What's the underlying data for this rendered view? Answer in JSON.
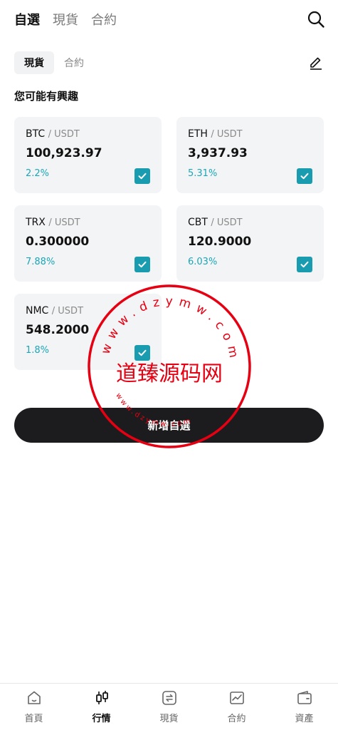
{
  "header": {
    "tabs": [
      {
        "label": "自選",
        "active": true
      },
      {
        "label": "現貨",
        "active": false
      },
      {
        "label": "合約",
        "active": false
      }
    ]
  },
  "sub_tabs": [
    {
      "label": "現貨",
      "active": true
    },
    {
      "label": "合約",
      "active": false
    }
  ],
  "section_title": "您可能有興趣",
  "cards": [
    {
      "base": "BTC",
      "quote": "/ USDT",
      "price": "100,923.97",
      "change": "2.2%",
      "checked": true
    },
    {
      "base": "ETH",
      "quote": "/ USDT",
      "price": "3,937.93",
      "change": "5.31%",
      "checked": true
    },
    {
      "base": "TRX",
      "quote": "/ USDT",
      "price": "0.300000",
      "change": "7.88%",
      "checked": true
    },
    {
      "base": "CBT",
      "quote": "/ USDT",
      "price": "120.9000",
      "change": "6.03%",
      "checked": true
    },
    {
      "base": "NMC",
      "quote": "/ USDT",
      "price": "548.2000",
      "change": "1.8%",
      "checked": true
    }
  ],
  "add_button_label": "新增自選",
  "watermark": {
    "text": "道臻源码网",
    "arc_text": "www.dzymw.com",
    "color": "#e60012"
  },
  "bottom_nav": [
    {
      "label": "首頁",
      "icon": "home-icon",
      "active": false
    },
    {
      "label": "行情",
      "icon": "candlestick-icon",
      "active": true
    },
    {
      "label": "現貨",
      "icon": "exchange-icon",
      "active": false
    },
    {
      "label": "合約",
      "icon": "chart-contract-icon",
      "active": false
    },
    {
      "label": "資產",
      "icon": "wallet-icon",
      "active": false
    }
  ],
  "colors": {
    "accent": "#1a9cb0",
    "change_text": "#1ba6b8",
    "button_bg": "#1c1c1e",
    "card_bg": "#f3f4f6"
  }
}
